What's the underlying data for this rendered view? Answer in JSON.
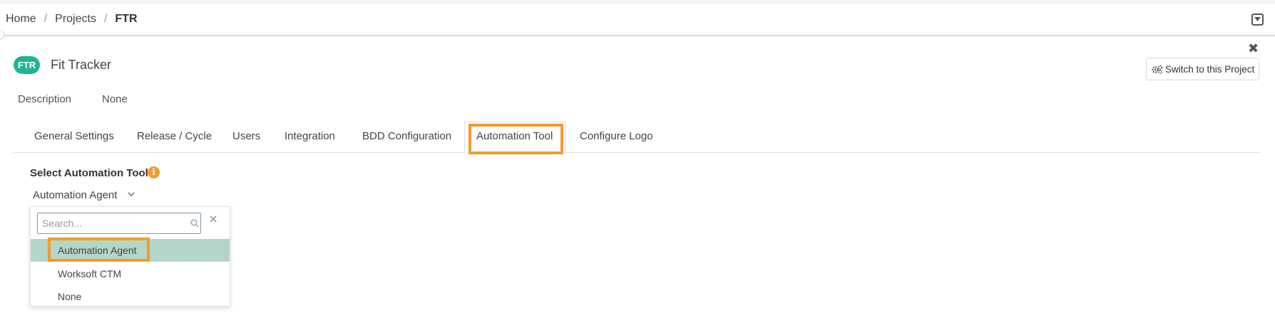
{
  "breadcrumb": {
    "items": [
      "Home",
      "Projects"
    ],
    "separator": "/",
    "current": "FTR"
  },
  "project": {
    "badge": "FTR",
    "title": "Fit Tracker",
    "switch_label": "Switch to this Project",
    "close_glyph": "✖"
  },
  "description": {
    "label": "Description",
    "value": "None"
  },
  "tabs": [
    {
      "label": "General Settings"
    },
    {
      "label": "Release / Cycle"
    },
    {
      "label": "Users"
    },
    {
      "label": "Integration"
    },
    {
      "label": "BDD Configuration"
    },
    {
      "label": "Automation Tool",
      "active": true
    },
    {
      "label": "Configure Logo"
    }
  ],
  "automation": {
    "section_label": "Select Automation Tool",
    "info_glyph": "i",
    "selected_value": "Automation Agent",
    "search_placeholder": "Search...",
    "options": [
      "Automation Agent",
      "Worksoft CTM",
      "None"
    ]
  },
  "colors": {
    "accent": "#23b294",
    "highlight": "#f39a2c",
    "selected_row": "#b3d6c9"
  }
}
